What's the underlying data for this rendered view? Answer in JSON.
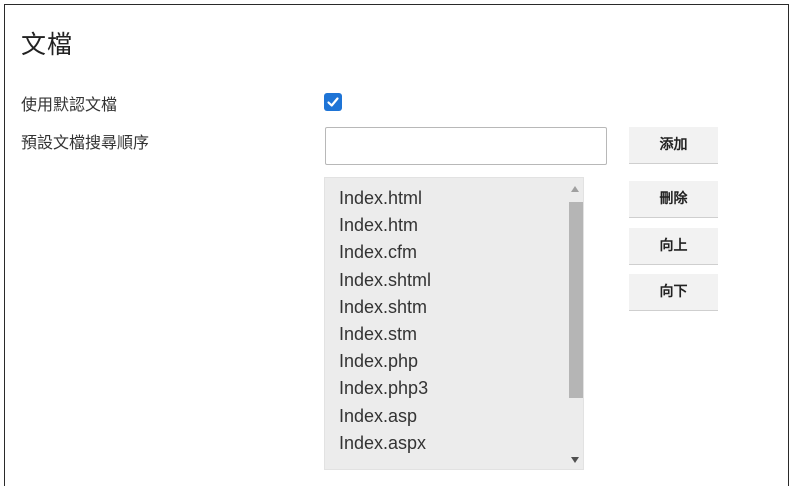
{
  "section": {
    "title": "文檔"
  },
  "settings": {
    "use_default_label": "使用默認文檔",
    "use_default_checked": true,
    "search_order_label": "預設文檔搜尋順序",
    "new_document_value": "",
    "new_document_placeholder": ""
  },
  "buttons": {
    "add": "添加",
    "delete": "刪除",
    "up": "向上",
    "down": "向下"
  },
  "documents": [
    "Index.html",
    "Index.htm",
    "Index.cfm",
    "Index.shtml",
    "Index.shtm",
    "Index.stm",
    "Index.php",
    "Index.php3",
    "Index.asp",
    "Index.aspx"
  ],
  "colors": {
    "checkbox_accent": "#1e74d6",
    "list_background": "#ececec",
    "button_background": "#f2f2f2"
  },
  "icons": {
    "checkbox": "check-icon",
    "scroll_up": "scroll-up-arrow-icon",
    "scroll_down": "scroll-down-arrow-icon"
  }
}
